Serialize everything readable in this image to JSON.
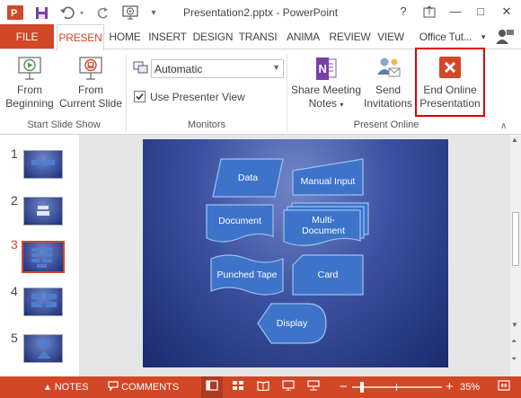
{
  "titlebar": {
    "title": "Presentation2.pptx - PowerPoint",
    "minimize": "—",
    "restore": "□",
    "close": "✕",
    "help": "?",
    "ribbon_display": "↑"
  },
  "tabs": {
    "file": "FILE",
    "presen": "PRESEN",
    "home": "HOME",
    "insert": "INSERT",
    "design": "DESIGN",
    "transi": "TRANSI",
    "anima": "ANIMA",
    "review": "REVIEW",
    "view": "VIEW",
    "account": "Office Tut..."
  },
  "ribbon": {
    "from_beginning": [
      "From",
      "Beginning"
    ],
    "from_current": [
      "From",
      "Current Slide"
    ],
    "start_group": "Start Slide Show",
    "monitor_value": "Automatic",
    "use_presenter_view": "Use Presenter View",
    "monitors_group": "Monitors",
    "share_meeting_notes": [
      "Share Meeting",
      "Notes"
    ],
    "send_invitations": [
      "Send",
      "Invitations"
    ],
    "end_online": [
      "End Online",
      "Presentation"
    ],
    "present_online_group": "Present Online"
  },
  "thumbnails": [
    "1",
    "2",
    "3",
    "4",
    "5"
  ],
  "selected_slide": "3",
  "slide_shapes": {
    "data": "Data",
    "manual_input": "Manual Input",
    "document": "Document",
    "multi_document": [
      "Multi-",
      "Document"
    ],
    "punched_tape": "Punched Tape",
    "card": "Card",
    "display": "Display"
  },
  "statusbar": {
    "notes": "NOTES",
    "comments": "COMMENTS",
    "zoom": "35%"
  },
  "colors": {
    "accent": "#d24726",
    "slide_bg": "#2a3c8c",
    "shape_fill": "#3d74c9",
    "highlight": "#e00000"
  }
}
